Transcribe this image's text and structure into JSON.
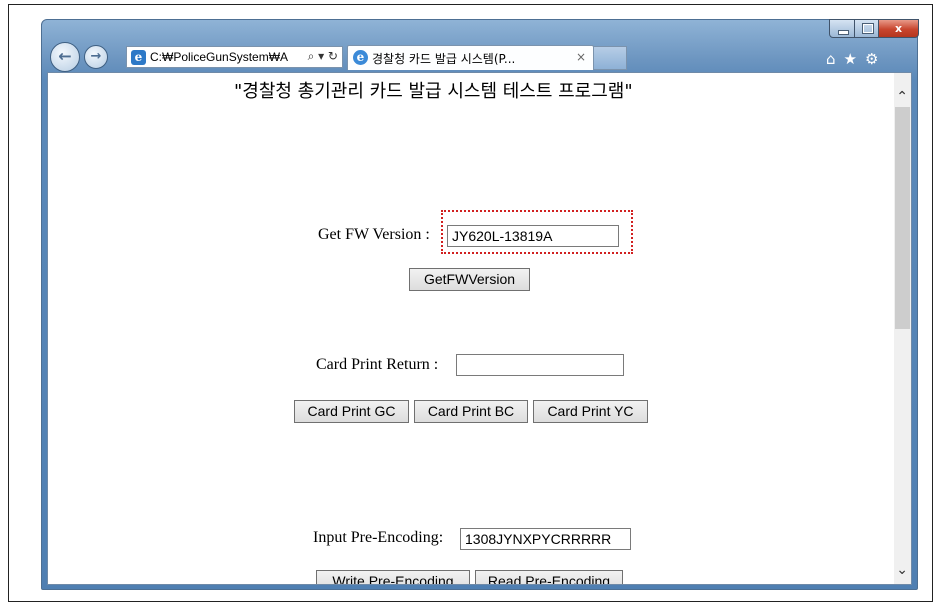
{
  "browser": {
    "address": "C:\\PolicePoliceGunSystem\\A",
    "address_icons": "⌕ ▾ ↻",
    "ie_icon_glyph": "e",
    "tab_title": "경찰청 카드 발급 시스템(P...",
    "tab_close": "×",
    "back_glyph": "←",
    "forward_glyph": "→",
    "toolbar_icons": "⌂★⚙",
    "window_close": "x"
  },
  "page": {
    "title": "\"경찰청 총기관리 카드 발급 시스템 테스트 프로그램\"",
    "fw_label": "Get FW Version :",
    "fw_value": "JY620L-13819A",
    "fw_button": "GetFWVersion",
    "card_return_label": "Card Print Return :",
    "card_return_value": "",
    "card_buttons": [
      "Card Print GC",
      "Card Print BC",
      "Card Print YC"
    ],
    "preenc_label": "Input Pre-Encoding:",
    "preenc_value": "1308JYNXPYCRRRRR",
    "write_button": "Write Pre-Encoding",
    "read_button": "Read Pre-Encoding"
  },
  "scroll": {
    "up": "⌃",
    "down": "⌄"
  }
}
